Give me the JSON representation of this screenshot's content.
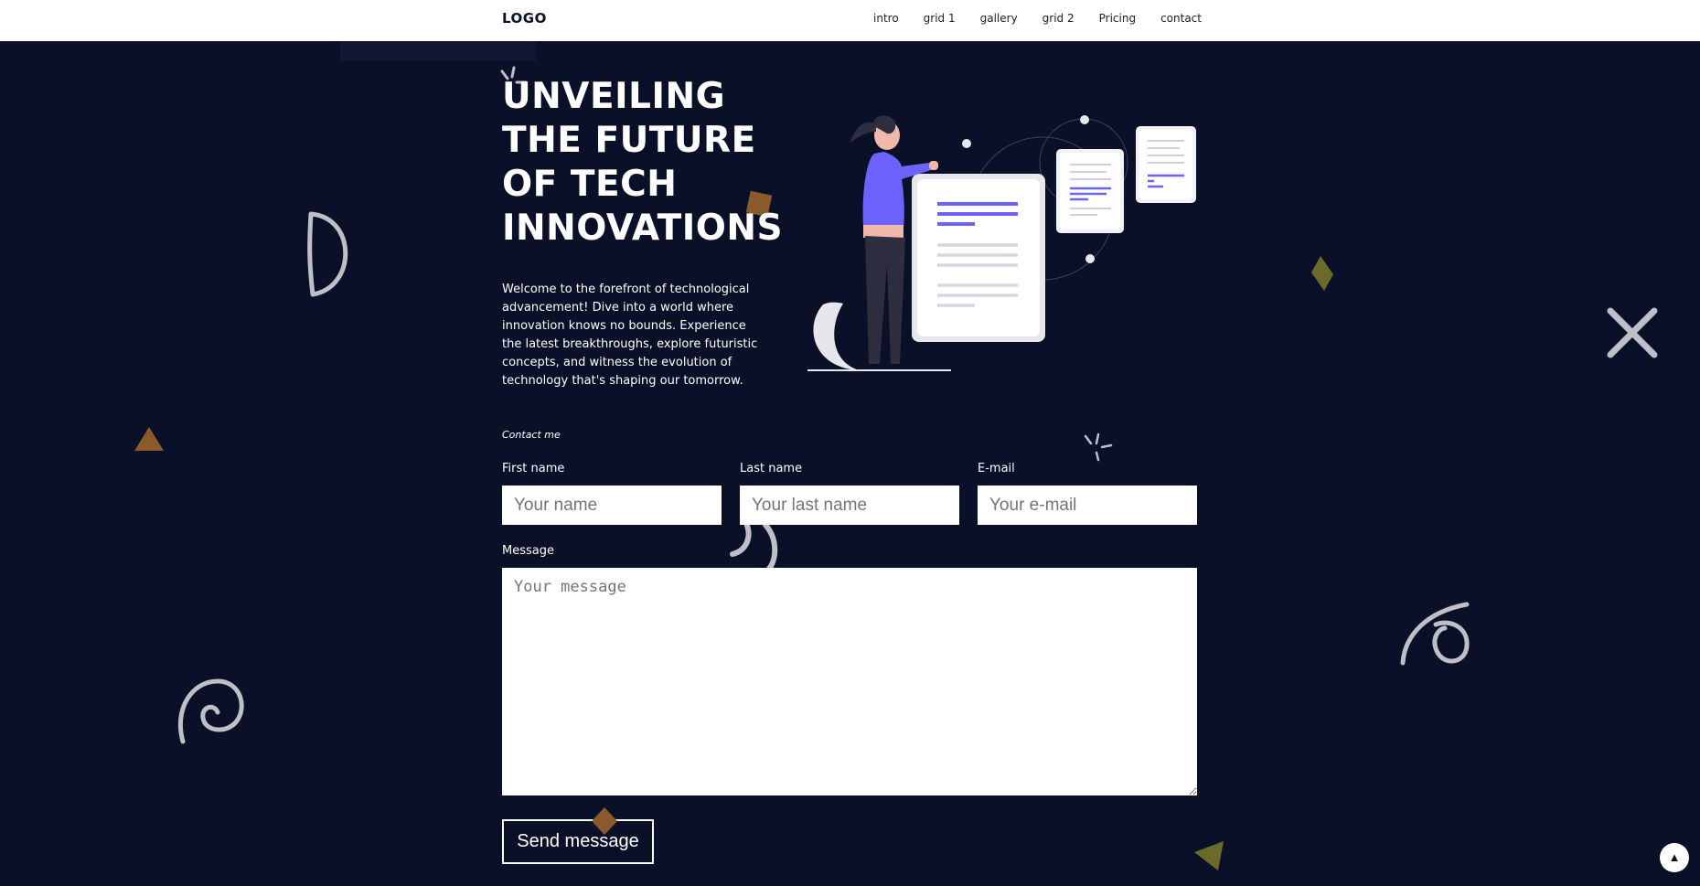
{
  "header": {
    "logo": "LOGO",
    "nav": [
      "intro",
      "grid 1",
      "gallery",
      "grid 2",
      "Pricing",
      "contact"
    ]
  },
  "hero": {
    "title_lines": [
      "UNVEILING",
      "THE FUTURE",
      "OF TECH",
      "INNOVATIONS"
    ],
    "description": "Welcome to the forefront of technological advancement! Dive into a world where innovation knows no bounds. Experience the latest breakthroughs, explore futuristic concepts, and witness the evolution of technology that's shaping our tomorrow."
  },
  "contact": {
    "heading": "Contact me",
    "first_name_label": "First name",
    "first_name_placeholder": "Your name",
    "last_name_label": "Last name",
    "last_name_placeholder": "Your last name",
    "email_label": "E-mail",
    "email_placeholder": "Your e-mail",
    "message_label": "Message",
    "message_placeholder": "Your message",
    "send_label": "Send message"
  },
  "scroll_top_icon": "arrow-up-icon",
  "colors": {
    "background": "#0b1029",
    "header": "#ffffff",
    "accent_purple": "#6c63ff",
    "deco_orange": "#8a5a2b",
    "deco_olive": "#6b6a2a",
    "deco_grey": "#bfbfc8"
  }
}
